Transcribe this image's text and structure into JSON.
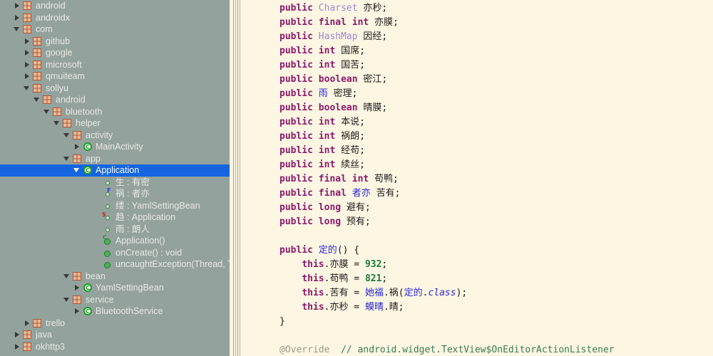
{
  "app": {
    "theme_colors": {
      "tree_background": "#93a29d",
      "tree_selection": "#1565e0",
      "editor_background": "#fdf6e3",
      "keyword": "#8b1a6b",
      "library_class": "#9b8ad6",
      "user_class": "#2727d8",
      "number": "#1a7a3c",
      "comment": "#3a7a57",
      "package_icon": "#b0563a",
      "member_icon": "#2f8f36"
    }
  },
  "project_tree": {
    "name": "project-structure-tree",
    "selected_node": "Application",
    "rows": [
      {
        "depth": 1,
        "arrow": "collapsed",
        "icon": "package-icon",
        "label": "android"
      },
      {
        "depth": 1,
        "arrow": "collapsed",
        "icon": "package-icon",
        "label": "androidx"
      },
      {
        "depth": 1,
        "arrow": "expanded",
        "icon": "package-icon",
        "label": "com"
      },
      {
        "depth": 2,
        "arrow": "collapsed",
        "icon": "package-icon",
        "label": "github"
      },
      {
        "depth": 2,
        "arrow": "collapsed",
        "icon": "package-icon",
        "label": "google"
      },
      {
        "depth": 2,
        "arrow": "collapsed",
        "icon": "package-icon",
        "label": "microsoft"
      },
      {
        "depth": 2,
        "arrow": "collapsed",
        "icon": "package-icon",
        "label": "qmuiteam"
      },
      {
        "depth": 2,
        "arrow": "expanded",
        "icon": "package-icon",
        "label": "sollyu"
      },
      {
        "depth": 3,
        "arrow": "expanded",
        "icon": "package-icon",
        "label": "android"
      },
      {
        "depth": 4,
        "arrow": "expanded",
        "icon": "package-icon",
        "label": "bluetooth"
      },
      {
        "depth": 5,
        "arrow": "expanded",
        "icon": "package-icon",
        "label": "helper"
      },
      {
        "depth": 6,
        "arrow": "expanded",
        "icon": "package-icon",
        "label": "activity"
      },
      {
        "depth": 7,
        "arrow": "collapsed",
        "icon": "class-icon",
        "label": "MainActivity"
      },
      {
        "depth": 6,
        "arrow": "expanded",
        "icon": "package-icon",
        "label": "app"
      },
      {
        "depth": 7,
        "arrow": "expanded",
        "icon": "class-icon",
        "label": "Application",
        "selected": true
      },
      {
        "depth": 9,
        "arrow": "none",
        "icon": "field-icon",
        "label": "生 : 有密"
      },
      {
        "depth": 9,
        "arrow": "none",
        "icon": "field-final-icon",
        "label": "祸 : 者亦"
      },
      {
        "depth": 9,
        "arrow": "none",
        "icon": "field-icon",
        "label": "缕 : YamlSettingBean"
      },
      {
        "depth": 9,
        "arrow": "none",
        "icon": "field-static-icon",
        "label": "趋 : Application"
      },
      {
        "depth": 9,
        "arrow": "none",
        "icon": "field-icon",
        "label": "雨 : 朗人"
      },
      {
        "depth": 9,
        "arrow": "none",
        "icon": "constructor-icon",
        "label": "Application()"
      },
      {
        "depth": 9,
        "arrow": "none",
        "icon": "method-icon",
        "label": "onCreate() : void"
      },
      {
        "depth": 9,
        "arrow": "none",
        "icon": "method-icon",
        "label": "uncaughtException(Thread, Thro"
      },
      {
        "depth": 6,
        "arrow": "expanded",
        "icon": "package-icon",
        "label": "bean"
      },
      {
        "depth": 7,
        "arrow": "collapsed",
        "icon": "class-icon",
        "label": "YamlSettingBean"
      },
      {
        "depth": 6,
        "arrow": "expanded",
        "icon": "package-icon",
        "label": "service"
      },
      {
        "depth": 7,
        "arrow": "collapsed",
        "icon": "class-icon",
        "label": "BluetoothService"
      },
      {
        "depth": 2,
        "arrow": "collapsed",
        "icon": "package-icon",
        "label": "trello"
      },
      {
        "depth": 1,
        "arrow": "collapsed",
        "icon": "package-icon",
        "label": "java"
      },
      {
        "depth": 1,
        "arrow": "collapsed",
        "icon": "package-icon",
        "label": "okhttp3"
      }
    ]
  },
  "editor": {
    "name": "code-editor",
    "language": "java",
    "lines": [
      [
        {
          "t": "public",
          "c": "kw"
        },
        {
          "t": " ",
          "c": "plain"
        },
        {
          "t": "Charset",
          "c": "jcls"
        },
        {
          "t": " 亦秒;",
          "c": "plain"
        }
      ],
      [
        {
          "t": "public final int",
          "c": "kw"
        },
        {
          "t": " 亦膜;",
          "c": "plain"
        }
      ],
      [
        {
          "t": "public",
          "c": "kw"
        },
        {
          "t": " ",
          "c": "plain"
        },
        {
          "t": "HashMap",
          "c": "jcls"
        },
        {
          "t": " 因经;",
          "c": "plain"
        }
      ],
      [
        {
          "t": "public int",
          "c": "kw"
        },
        {
          "t": " 国席;",
          "c": "plain"
        }
      ],
      [
        {
          "t": "public int",
          "c": "kw"
        },
        {
          "t": " 国苦;",
          "c": "plain"
        }
      ],
      [
        {
          "t": "public boolean",
          "c": "kw"
        },
        {
          "t": " 密江;",
          "c": "plain"
        }
      ],
      [
        {
          "t": "public",
          "c": "kw"
        },
        {
          "t": " ",
          "c": "plain"
        },
        {
          "t": "雨",
          "c": "ucls"
        },
        {
          "t": " 密理;",
          "c": "plain"
        }
      ],
      [
        {
          "t": "public boolean",
          "c": "kw"
        },
        {
          "t": " 晴膜;",
          "c": "plain"
        }
      ],
      [
        {
          "t": "public int",
          "c": "kw"
        },
        {
          "t": " 本说;",
          "c": "plain"
        }
      ],
      [
        {
          "t": "public int",
          "c": "kw"
        },
        {
          "t": " 祸朗;",
          "c": "plain"
        }
      ],
      [
        {
          "t": "public int",
          "c": "kw"
        },
        {
          "t": " 经苟;",
          "c": "plain"
        }
      ],
      [
        {
          "t": "public int",
          "c": "kw"
        },
        {
          "t": " 续丝;",
          "c": "plain"
        }
      ],
      [
        {
          "t": "public final int",
          "c": "kw"
        },
        {
          "t": " 苟鸭;",
          "c": "plain"
        }
      ],
      [
        {
          "t": "public final",
          "c": "kw"
        },
        {
          "t": " ",
          "c": "plain"
        },
        {
          "t": "者亦",
          "c": "ucls"
        },
        {
          "t": " 苦有;",
          "c": "plain"
        }
      ],
      [
        {
          "t": "public long",
          "c": "kw"
        },
        {
          "t": " 避有;",
          "c": "plain"
        }
      ],
      [
        {
          "t": "public long",
          "c": "kw"
        },
        {
          "t": " 预有;",
          "c": "plain"
        }
      ],
      [
        {
          "t": "",
          "c": "plain"
        }
      ],
      [
        {
          "t": "public",
          "c": "kw"
        },
        {
          "t": " ",
          "c": "plain"
        },
        {
          "t": "定的",
          "c": "ucls"
        },
        {
          "t": "() {",
          "c": "plain"
        }
      ],
      [
        {
          "t": "    ",
          "c": "plain"
        },
        {
          "t": "this",
          "c": "kw"
        },
        {
          "t": ".亦膜 = ",
          "c": "plain"
        },
        {
          "t": "932",
          "c": "num"
        },
        {
          "t": ";",
          "c": "plain"
        }
      ],
      [
        {
          "t": "    ",
          "c": "plain"
        },
        {
          "t": "this",
          "c": "kw"
        },
        {
          "t": ".苟鸭 = ",
          "c": "plain"
        },
        {
          "t": "821",
          "c": "num"
        },
        {
          "t": ";",
          "c": "plain"
        }
      ],
      [
        {
          "t": "    ",
          "c": "plain"
        },
        {
          "t": "this",
          "c": "kw"
        },
        {
          "t": ".苦有 = ",
          "c": "plain"
        },
        {
          "t": "她福",
          "c": "ucls"
        },
        {
          "t": ".祸(",
          "c": "plain"
        },
        {
          "t": "定的",
          "c": "ucls"
        },
        {
          "t": ".",
          "c": "plain"
        },
        {
          "t": "class",
          "c": "ital"
        },
        {
          "t": ");",
          "c": "plain"
        }
      ],
      [
        {
          "t": "    ",
          "c": "plain"
        },
        {
          "t": "this",
          "c": "kw"
        },
        {
          "t": ".亦秒 = ",
          "c": "plain"
        },
        {
          "t": "蟆晴",
          "c": "ucls"
        },
        {
          "t": ".晴;",
          "c": "plain"
        }
      ],
      [
        {
          "t": "}",
          "c": "plain"
        }
      ],
      [
        {
          "t": "",
          "c": "plain"
        }
      ],
      [
        {
          "t": "@Override",
          "c": "ann"
        },
        {
          "t": "  ",
          "c": "plain"
        },
        {
          "t": "// android.widget.TextView$OnEditorActionListener",
          "c": "cmt"
        }
      ]
    ]
  }
}
